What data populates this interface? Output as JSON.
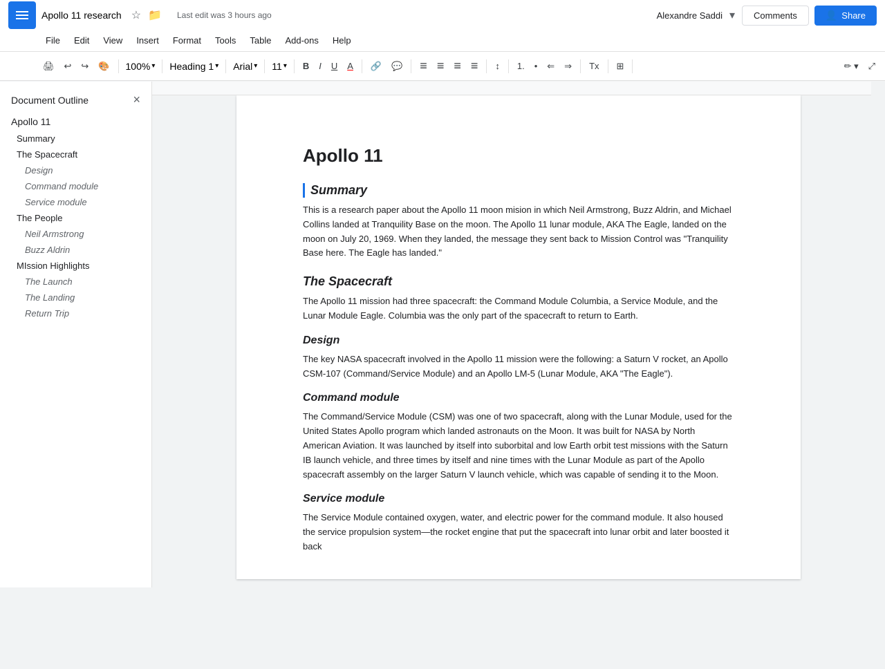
{
  "app": {
    "menu_icon": "☰",
    "title": "Apollo 11 research",
    "star_icon": "☆",
    "folder_icon": "📁",
    "last_edit": "Last edit was 3 hours ago",
    "user_name": "Alexandre Saddi",
    "user_chevron": "▾",
    "comments_label": "Comments",
    "share_label": "Share",
    "share_person_icon": "👤"
  },
  "menubar": {
    "items": [
      "File",
      "Edit",
      "View",
      "Insert",
      "Format",
      "Tools",
      "Table",
      "Add-ons",
      "Help"
    ]
  },
  "toolbar": {
    "print_icon": "🖨",
    "undo_icon": "↩",
    "redo_icon": "↪",
    "paint_icon": "🎨",
    "zoom": "100%",
    "zoom_chevron": "▾",
    "style": "Heading 1",
    "style_chevron": "▾",
    "font": "Arial",
    "font_chevron": "▾",
    "font_size": "11",
    "font_size_chevron": "▾",
    "bold": "B",
    "italic": "I",
    "underline": "U",
    "text_color": "A",
    "link_icon": "🔗",
    "comment_icon": "💬",
    "align_left": "≡",
    "align_center": "≡",
    "align_right": "≡",
    "align_justify": "≡",
    "line_spacing": "↕",
    "numbered_list": "1.",
    "bulleted_list": "•",
    "decrease_indent": "⇐",
    "increase_indent": "⇒",
    "clear_format": "Tx",
    "columns": "⊞",
    "edit_mode": "✏",
    "expand": "⤢"
  },
  "sidebar": {
    "title": "Document Outline",
    "close_icon": "×",
    "items": [
      {
        "text": "Apollo 11",
        "level": "h1"
      },
      {
        "text": "Summary",
        "level": "h2",
        "active": true
      },
      {
        "text": "The Spacecraft",
        "level": "h2"
      },
      {
        "text": "Design",
        "level": "h3"
      },
      {
        "text": "Command module",
        "level": "h3"
      },
      {
        "text": "Service module",
        "level": "h3"
      },
      {
        "text": "The People",
        "level": "h2"
      },
      {
        "text": "Neil Armstrong",
        "level": "h3"
      },
      {
        "text": "Buzz Aldrin",
        "level": "h3"
      },
      {
        "text": "MIssion Highlights",
        "level": "h2"
      },
      {
        "text": "The Launch",
        "level": "h3"
      },
      {
        "text": "The Landing",
        "level": "h3"
      },
      {
        "text": "Return Trip",
        "level": "h3"
      }
    ]
  },
  "document": {
    "title": "Apollo 11",
    "sections": [
      {
        "heading": "Summary",
        "level": "h2",
        "has_border": true,
        "body": "This is a research paper about the Apollo 11 moon mision in which Neil Armstrong, Buzz Aldrin, and Michael Collins landed at Tranquility Base on the moon. The Apollo 11 lunar module, AKA The Eagle, landed on the moon on July 20, 1969. When they landed, the message they sent back to Mission Control was \"Tranquility Base here. The Eagle has landed.\""
      },
      {
        "heading": "The Spacecraft",
        "level": "h2",
        "has_border": false,
        "body": "The Apollo 11 mission had three spacecraft: the Command Module Columbia, a Service Module, and the Lunar Module Eagle. Columbia was the only part of the spacecraft to return to Earth."
      },
      {
        "heading": "Design",
        "level": "h3",
        "has_border": false,
        "body": "The key NASA spacecraft involved in the Apollo 11 mission were the following: a Saturn V rocket, an Apollo CSM-107 (Command/Service Module)  and an Apollo LM-5 (Lunar Module, AKA \"The Eagle\")."
      },
      {
        "heading": "Command module",
        "level": "h3",
        "has_border": false,
        "body": "The Command/Service Module (CSM) was one of two spacecraft, along with the Lunar Module, used for the United States Apollo program which landed astronauts on the Moon. It was built for NASA by North American Aviation. It was launched by itself into suborbital and low Earth orbit test missions with the Saturn IB launch vehicle, and three times by itself and nine times with the Lunar Module as part of the Apollo spacecraft assembly on the larger Saturn V launch vehicle, which was capable of sending it to the Moon."
      },
      {
        "heading": "Service module",
        "level": "h3",
        "has_border": false,
        "body": "The Service Module contained oxygen, water, and electric power for the command module. It also housed the service propulsion system—the rocket engine that put the spacecraft into lunar orbit and later boosted it back"
      }
    ]
  }
}
